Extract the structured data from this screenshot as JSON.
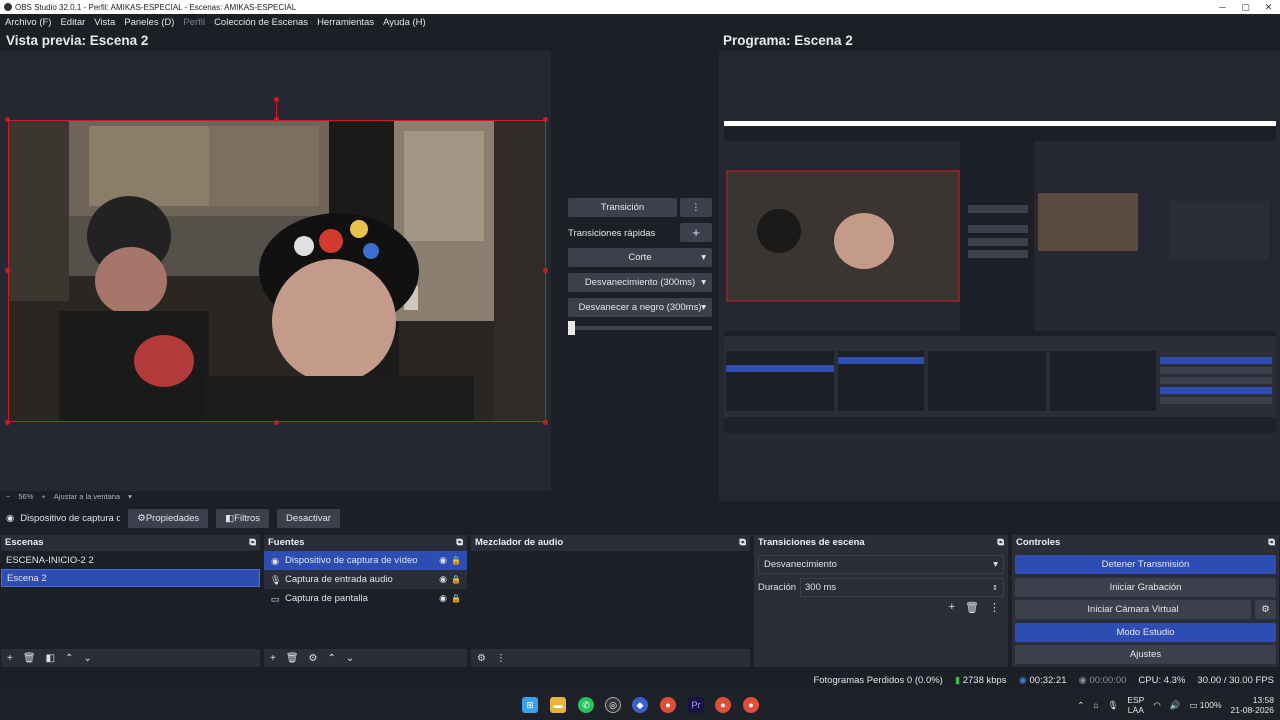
{
  "window": {
    "title": "OBS Studio 32.0.1 - Perfil: AMIKAS-ESPECIAL - Escenas: AMIKAS-ESPECIAL"
  },
  "menu": [
    "Archivo (F)",
    "Editar",
    "Vista",
    "Paneles (D)",
    "Perfil",
    "Colección de Escenas",
    "Herramientas",
    "Ayuda (H)"
  ],
  "preview": {
    "title": "Vista previa: Escena 2",
    "zoom": "56%",
    "fit_label": "Ajustar a la ventana"
  },
  "program": {
    "title": "Programa: Escena 2"
  },
  "middle": {
    "transition_button": "Transición",
    "quick_transitions_label": "Transiciones rápidas",
    "quick": [
      "Corte",
      "Desvanecimiento (300ms)",
      "Desvanecer a negro (300ms)"
    ]
  },
  "source_toolbar": {
    "current_source": "Dispositivo de captura de v",
    "properties": "Propiedades",
    "filters": "Filtros",
    "deactivate": "Desactivar"
  },
  "scenes": {
    "title": "Escenas",
    "items": [
      "ESCENA-INICIO-2 2",
      "Escena 2"
    ],
    "selected_index": 1
  },
  "sources": {
    "title": "Fuentes",
    "items": [
      {
        "label": "Dispositivo de captura de vídeo",
        "icon": "camera-icon"
      },
      {
        "label": "Captura de entrada audio",
        "icon": "microphone-icon"
      },
      {
        "label": "Captura de pantalla",
        "icon": "monitor-icon"
      }
    ]
  },
  "mixer": {
    "title": "Mezclador de audio"
  },
  "transitions": {
    "title": "Transiciones de escena",
    "selected": "Desvanecimiento",
    "duration_label": "Duración",
    "duration_value": "300 ms"
  },
  "controls": {
    "title": "Controles",
    "buttons": [
      "Detener Transmisión",
      "Iniciar Grabación",
      "Iniciar Cámara Virtual",
      "Modo Estudio",
      "Ajustes"
    ]
  },
  "status": {
    "dropped_frames": "Fotogramas Perdidos 0 (0.0%)",
    "bitrate": "2738 kbps",
    "stream_time": "00:32:21",
    "rec_time": "00:00:00",
    "cpu": "CPU: 4.3%",
    "fps": "30.00 / 30.00 FPS"
  },
  "tray": {
    "lang_top": "ESP",
    "lang_bottom": "LAA",
    "battery": "100%",
    "time": "13:58",
    "date": "21-08-2026"
  },
  "colors": {
    "accent": "#2d4db3",
    "selection_red": "#d01a22",
    "panel": "#2b2e38",
    "background": "#1d1f26"
  }
}
